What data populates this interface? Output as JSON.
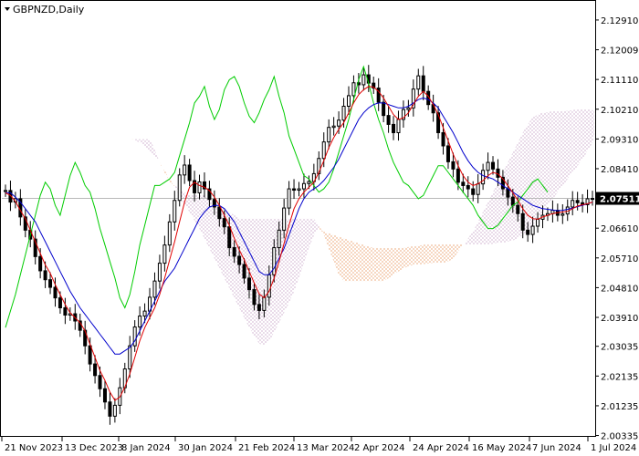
{
  "window": {
    "title": "GBPNZD,Daily"
  },
  "colors": {
    "background": "#ffffff",
    "frame": "#000000",
    "candle": "#000000",
    "tenkan": "#e00000",
    "kijun": "#0000cc",
    "chikou": "#00cc00",
    "kumo_bull": "#e07020",
    "kumo_bear": "#b080b0",
    "current_line": "#b8b8b8",
    "price_tag_bg": "#000000"
  },
  "chart_data": {
    "type": "candlestick",
    "symbol": "GBPNZD",
    "timeframe": "Daily",
    "indicator": "Ichimoku Kinko Hyo",
    "current_price": "2.07511",
    "ylim": [
      2.0035,
      2.1346
    ],
    "y_ticks": [
      "2.12910",
      "2.12009",
      "2.11110",
      "2.10210",
      "2.09310",
      "2.08410",
      "2.07511",
      "2.06610",
      "2.05710",
      "2.04810",
      "2.03910",
      "2.03035",
      "2.02135",
      "2.01235",
      "2.00335"
    ],
    "x_ticks": [
      "21 Nov 2023",
      "13 Dec 2023",
      "8 Jan 2024",
      "30 Jan 2024",
      "21 Feb 2024",
      "13 Mar 2024",
      "2 Apr 2024",
      "24 Apr 2024",
      "16 May 2024",
      "7 Jun 2024",
      "1 Jul 2024"
    ],
    "grid": false,
    "candles": {
      "open": [
        2.0772,
        2.0775,
        2.074,
        2.075,
        2.0695,
        2.0655,
        2.0628,
        2.0575,
        2.0532,
        2.0505,
        2.0482,
        2.045,
        2.042,
        2.0398,
        2.0402,
        2.038,
        2.0352,
        2.0305,
        2.025,
        2.0215,
        2.0175,
        2.0135,
        2.0092,
        2.0125,
        2.0178,
        2.0235,
        2.0305,
        2.0362,
        2.0395,
        2.041,
        2.0452,
        2.0501,
        2.0555,
        2.061,
        2.068,
        2.0745,
        2.0822,
        2.0852,
        2.0805,
        2.0768,
        2.0801,
        2.078,
        2.0748,
        2.0725,
        2.069,
        2.0665,
        2.0602,
        2.0576,
        2.0551,
        2.051,
        2.0475,
        2.043,
        2.0412,
        2.0452,
        2.052,
        2.0602,
        2.0655,
        2.0722,
        2.078,
        2.0776,
        2.078,
        2.0796,
        2.0802,
        2.0826,
        2.0872,
        2.0922,
        2.0966,
        2.097,
        2.0988,
        2.103,
        2.1062,
        2.1101,
        2.1095,
        2.1125,
        2.11,
        2.1085,
        2.1042,
        2.1002,
        2.0975,
        2.095,
        2.099,
        2.102,
        2.1025,
        2.1082,
        2.1122,
        2.1075,
        2.1035,
        2.101,
        2.095,
        2.091,
        2.0862,
        2.084,
        2.08,
        2.079,
        2.078,
        2.0763,
        2.0795,
        2.0836,
        2.086,
        2.084,
        2.0815,
        2.078,
        2.0755,
        2.073,
        2.0705,
        2.0655,
        2.0642,
        2.0667,
        2.0688,
        2.07,
        2.0705,
        2.0715,
        2.07,
        2.0704,
        2.0725,
        2.0745,
        2.0738,
        2.0732,
        2.075
      ],
      "close": [
        2.0775,
        2.074,
        2.075,
        2.0695,
        2.0655,
        2.0628,
        2.0575,
        2.0532,
        2.0505,
        2.0482,
        2.045,
        2.042,
        2.0398,
        2.0402,
        2.038,
        2.0352,
        2.0305,
        2.025,
        2.0215,
        2.0175,
        2.0135,
        2.0092,
        2.0125,
        2.0178,
        2.0235,
        2.0305,
        2.0362,
        2.0395,
        2.041,
        2.0452,
        2.0501,
        2.0555,
        2.061,
        2.068,
        2.0745,
        2.0822,
        2.0852,
        2.0805,
        2.0768,
        2.0801,
        2.078,
        2.0748,
        2.0725,
        2.069,
        2.0665,
        2.0602,
        2.0576,
        2.0551,
        2.051,
        2.0475,
        2.043,
        2.0412,
        2.0452,
        2.052,
        2.0602,
        2.0655,
        2.0722,
        2.078,
        2.0776,
        2.078,
        2.0796,
        2.0802,
        2.0826,
        2.0872,
        2.0922,
        2.0966,
        2.097,
        2.0988,
        2.103,
        2.1062,
        2.1101,
        2.1095,
        2.1125,
        2.11,
        2.1085,
        2.1042,
        2.1002,
        2.0975,
        2.095,
        2.099,
        2.102,
        2.1025,
        2.1082,
        2.1122,
        2.1075,
        2.1035,
        2.101,
        2.095,
        2.091,
        2.0862,
        2.084,
        2.08,
        2.079,
        2.078,
        2.0763,
        2.0795,
        2.0836,
        2.086,
        2.084,
        2.0815,
        2.078,
        2.0755,
        2.073,
        2.0705,
        2.0655,
        2.0642,
        2.0667,
        2.0688,
        2.07,
        2.0705,
        2.0715,
        2.07,
        2.0704,
        2.0725,
        2.0745,
        2.0738,
        2.0732,
        2.075,
        2.0751
      ]
    },
    "tenkan": [
      2.0768,
      2.076,
      2.0742,
      2.0715,
      2.069,
      2.0655,
      2.062,
      2.0585,
      2.055,
      2.0525,
      2.049,
      2.046,
      2.043,
      2.0405,
      2.039,
      2.0375,
      2.035,
      2.031,
      2.027,
      2.023,
      2.02,
      2.0165,
      2.014,
      2.015,
      2.018,
      2.022,
      2.027,
      2.032,
      2.036,
      2.039,
      2.042,
      2.046,
      2.051,
      2.0565,
      2.062,
      2.068,
      2.074,
      2.0785,
      2.08,
      2.079,
      2.0785,
      2.0775,
      2.0755,
      2.073,
      2.07,
      2.067,
      2.063,
      2.0595,
      2.0565,
      2.053,
      2.0495,
      2.0462,
      2.045,
      2.047,
      2.051,
      2.056,
      2.0615,
      2.067,
      2.072,
      2.075,
      2.077,
      2.0785,
      2.08,
      2.083,
      2.0865,
      2.0905,
      2.0935,
      2.096,
      2.098,
      2.101,
      2.104,
      2.1065,
      2.108,
      2.109,
      2.1088,
      2.1075,
      2.1055,
      2.103,
      2.1005,
      2.099,
      2.0995,
      2.101,
      2.1035,
      2.106,
      2.1075,
      2.106,
      2.1035,
      2.1005,
      2.0965,
      2.0925,
      2.0885,
      2.085,
      2.082,
      2.08,
      2.079,
      2.0795,
      2.0805,
      2.082,
      2.083,
      2.0825,
      2.081,
      2.079,
      2.0768,
      2.0745,
      2.072,
      2.07,
      2.069,
      2.0688,
      2.0695,
      2.07,
      2.0705,
      2.0708,
      2.071,
      2.0712,
      2.072,
      2.0728,
      2.0732,
      2.0735,
      2.074,
      2.0745
    ],
    "kijun": [
      2.0768,
      2.0768,
      2.0755,
      2.074,
      2.072,
      2.07,
      2.068,
      2.065,
      2.062,
      2.059,
      2.056,
      2.053,
      2.05,
      2.047,
      2.0445,
      2.042,
      2.04,
      2.038,
      2.036,
      2.034,
      2.032,
      2.03,
      2.028,
      2.028,
      2.029,
      2.03,
      2.032,
      2.035,
      2.038,
      2.041,
      2.044,
      2.047,
      2.05,
      2.052,
      2.054,
      2.057,
      2.06,
      2.063,
      2.066,
      2.069,
      2.071,
      2.0725,
      2.073,
      2.073,
      2.072,
      2.07,
      2.068,
      2.065,
      2.062,
      2.059,
      2.056,
      2.053,
      2.052,
      2.052,
      2.054,
      2.057,
      2.06,
      2.064,
      2.068,
      2.072,
      2.075,
      2.077,
      2.078,
      2.079,
      2.0805,
      2.0825,
      2.0845,
      2.087,
      2.09,
      2.093,
      2.096,
      2.099,
      2.101,
      2.1025,
      2.1035,
      2.104,
      2.104,
      2.1035,
      2.103,
      2.1025,
      2.1025,
      2.103,
      2.104,
      2.105,
      2.1055,
      2.105,
      2.104,
      2.1025,
      2.1,
      2.0975,
      2.095,
      2.092,
      2.089,
      2.0865,
      2.0845,
      2.083,
      2.082,
      2.0815,
      2.081,
      2.08,
      2.079,
      2.078,
      2.077,
      2.076,
      2.075,
      2.074,
      2.073,
      2.0725,
      2.072,
      2.0718,
      2.0716,
      2.0714,
      2.0715,
      2.0718,
      2.0722,
      2.0726,
      2.073,
      2.0735,
      2.074,
      2.0745
    ],
    "chikou": [
      2.031,
      2.036,
      2.041,
      2.046,
      2.052,
      2.058,
      2.064,
      2.07,
      2.076,
      2.08,
      2.078,
      2.073,
      2.07,
      2.076,
      2.082,
      2.086,
      2.083,
      2.079,
      2.077,
      2.072,
      2.066,
      2.061,
      2.056,
      2.051,
      2.045,
      2.042,
      2.046,
      2.053,
      2.061,
      2.067,
      2.073,
      2.079,
      2.079,
      2.08,
      2.081,
      2.083,
      2.088,
      2.093,
      2.098,
      2.104,
      2.106,
      2.109,
      2.103,
      2.099,
      2.102,
      2.108,
      2.111,
      2.112,
      2.109,
      2.104,
      2.1,
      2.098,
      2.101,
      2.105,
      2.108,
      2.112,
      2.106,
      2.101,
      2.094,
      2.09,
      2.086,
      2.082,
      2.081,
      2.079,
      2.077,
      2.078,
      2.08,
      2.084,
      2.089,
      2.094,
      2.099,
      2.105,
      2.111,
      2.115,
      2.11,
      2.104,
      2.099,
      2.095,
      2.09,
      2.086,
      2.083,
      2.08,
      2.079,
      2.077,
      2.075,
      2.076,
      2.079,
      2.082,
      2.085,
      2.085,
      2.083,
      2.081,
      2.079,
      2.077,
      2.075,
      2.073,
      2.07,
      2.068,
      2.066,
      2.066,
      2.067,
      2.069,
      2.071,
      2.073,
      2.074,
      2.076,
      2.078,
      2.08,
      2.081,
      2.079,
      2.077
    ],
    "senkou_a": [
      2.0932,
      2.0928,
      2.092,
      2.091,
      2.0895,
      2.088,
      2.086,
      2.0835,
      2.081,
      2.0785,
      2.076,
      2.0735,
      2.071,
      2.0685,
      2.066,
      2.063,
      2.06,
      2.057,
      2.054,
      2.051,
      2.048,
      2.045,
      2.042,
      2.039,
      2.036,
      2.0335,
      2.0312,
      2.0305,
      2.032,
      2.0345,
      2.0375,
      2.0405,
      2.0435,
      2.047,
      2.051,
      2.0555,
      2.06,
      2.064,
      2.066,
      2.065,
      2.0645,
      2.064,
      2.0635,
      2.063,
      2.0625,
      2.062,
      2.0615,
      2.061,
      2.0605,
      2.0602,
      2.06,
      2.06,
      2.06,
      2.06,
      2.0601,
      2.0602,
      2.0604,
      2.0606,
      2.0608,
      2.061,
      2.0612,
      2.0612,
      2.0612,
      2.0612,
      2.0612,
      2.0612,
      2.0612,
      2.0612,
      2.0612,
      2.0612,
      2.0612,
      2.0612,
      2.0613,
      2.0614,
      2.0616,
      2.0618,
      2.062,
      2.0624,
      2.063,
      2.064,
      2.0655,
      2.067,
      2.069,
      2.071,
      2.073,
      2.075,
      2.077,
      2.079,
      2.081,
      2.083,
      2.085,
      2.087,
      2.0895,
      2.092,
      2.0945,
      2.0965,
      2.0975,
      2.0985,
      2.099,
      2.0995,
      2.1,
      2.101,
      2.102,
      2.1028,
      2.103,
      2.103,
      2.1028,
      2.102,
      2.101,
      2.0995,
      2.098,
      2.0965,
      2.095,
      2.094,
      2.093,
      2.0925,
      2.092,
      2.0925,
      2.093,
      2.0935
    ],
    "senkou_b": [
      2.093,
      2.093,
      2.093,
      2.093,
      2.093,
      2.09,
      2.086,
      2.083,
      2.08,
      2.079,
      2.078,
      2.077,
      2.076,
      2.076,
      2.076,
      2.076,
      2.075,
      2.074,
      2.073,
      2.072,
      2.071,
      2.07,
      2.069,
      2.069,
      2.069,
      2.069,
      2.069,
      2.069,
      2.069,
      2.069,
      2.069,
      2.069,
      2.069,
      2.069,
      2.069,
      2.069,
      2.069,
      2.069,
      2.067,
      2.064,
      2.06,
      2.056,
      2.052,
      2.05,
      2.05,
      2.05,
      2.05,
      2.05,
      2.05,
      2.05,
      2.05,
      2.05,
      2.051,
      2.052,
      2.053,
      2.054,
      2.0545,
      2.055,
      2.0552,
      2.0553,
      2.0554,
      2.0555,
      2.0556,
      2.0557,
      2.056,
      2.057,
      2.059,
      2.061,
      2.063,
      2.065,
      2.068,
      2.071,
      2.074,
      2.077,
      2.08,
      2.083,
      2.086,
      2.089,
      2.092,
      2.095,
      2.0975,
      2.0995,
      2.1005,
      2.101,
      2.1012,
      2.1014,
      2.1015,
      2.1016,
      2.1017,
      2.1018,
      2.102,
      2.102,
      2.102,
      2.1018,
      2.1016,
      2.1014,
      2.1012,
      2.101,
      2.1008,
      2.1006,
      2.1004,
      2.1002,
      2.1,
      2.0995,
      2.099,
      2.0985,
      2.0975,
      2.0965,
      2.0955,
      2.0945,
      2.0935,
      2.0925,
      2.0915,
      2.0905,
      2.0895,
      2.089,
      2.0888,
      2.0887,
      2.0886,
      2.0885
    ]
  }
}
